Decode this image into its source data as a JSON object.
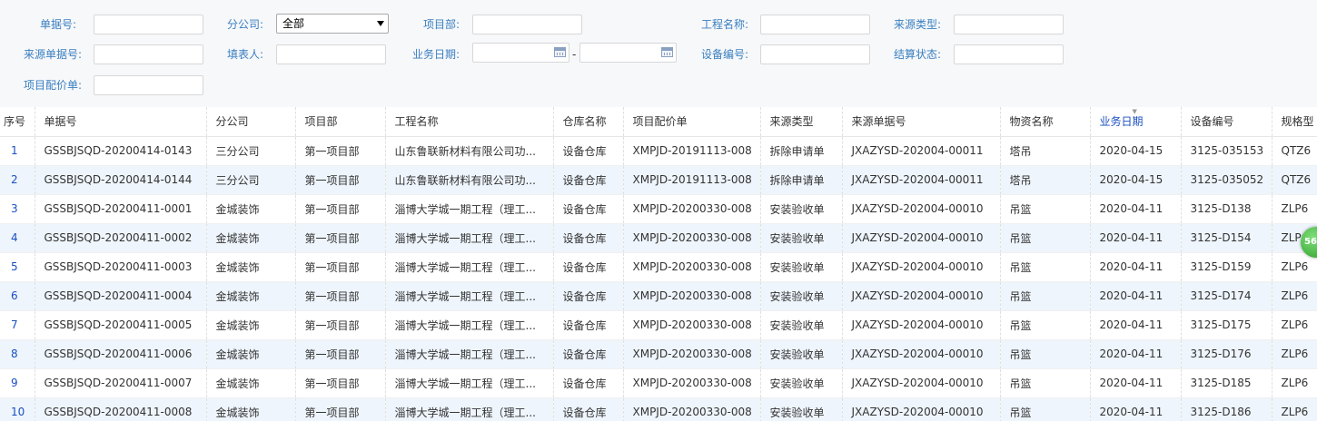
{
  "filters": {
    "doc_no": {
      "label": "单据号:",
      "value": ""
    },
    "branch": {
      "label": "分公司:",
      "value": "全部"
    },
    "project_dept": {
      "label": "项目部:",
      "value": ""
    },
    "project_name": {
      "label": "工程名称:",
      "value": ""
    },
    "source_type": {
      "label": "来源类型:",
      "value": ""
    },
    "source_doc_no": {
      "label": "来源单据号:",
      "value": ""
    },
    "filler": {
      "label": "填表人:",
      "value": ""
    },
    "business_date": {
      "label": "业务日期:",
      "from": "",
      "to": "",
      "separator": "-"
    },
    "equipment_no": {
      "label": "设备编号:",
      "value": ""
    },
    "settlement_status": {
      "label": "结算状态:",
      "value": ""
    },
    "price_list": {
      "label": "项目配价单:",
      "value": ""
    }
  },
  "table": {
    "columns": [
      "序号",
      "单据号",
      "分公司",
      "项目部",
      "工程名称",
      "仓库名称",
      "项目配价单",
      "来源类型",
      "来源单据号",
      "物资名称",
      "业务日期",
      "设备编号",
      "规格型"
    ],
    "sorted_column": "业务日期",
    "rows": [
      [
        "1",
        "GSSBJSQD-20200414-0143",
        "三分公司",
        "第一项目部",
        "山东鲁联新材料有限公司功...",
        "设备仓库",
        "XMPJD-20191113-008",
        "拆除申请单",
        "JXAZYSD-202004-00011",
        "塔吊",
        "2020-04-15",
        "3125-035153",
        "QTZ6"
      ],
      [
        "2",
        "GSSBJSQD-20200414-0144",
        "三分公司",
        "第一项目部",
        "山东鲁联新材料有限公司功...",
        "设备仓库",
        "XMPJD-20191113-008",
        "拆除申请单",
        "JXAZYSD-202004-00011",
        "塔吊",
        "2020-04-15",
        "3125-035052",
        "QTZ6"
      ],
      [
        "3",
        "GSSBJSQD-20200411-0001",
        "金城装饰",
        "第一项目部",
        "淄博大学城一期工程（理工...",
        "设备仓库",
        "XMPJD-20200330-008",
        "安装验收单",
        "JXAZYSD-202004-00010",
        "吊篮",
        "2020-04-11",
        "3125-D138",
        "ZLP6"
      ],
      [
        "4",
        "GSSBJSQD-20200411-0002",
        "金城装饰",
        "第一项目部",
        "淄博大学城一期工程（理工...",
        "设备仓库",
        "XMPJD-20200330-008",
        "安装验收单",
        "JXAZYSD-202004-00010",
        "吊篮",
        "2020-04-11",
        "3125-D154",
        "ZLP6"
      ],
      [
        "5",
        "GSSBJSQD-20200411-0003",
        "金城装饰",
        "第一项目部",
        "淄博大学城一期工程（理工...",
        "设备仓库",
        "XMPJD-20200330-008",
        "安装验收单",
        "JXAZYSD-202004-00010",
        "吊篮",
        "2020-04-11",
        "3125-D159",
        "ZLP6"
      ],
      [
        "6",
        "GSSBJSQD-20200411-0004",
        "金城装饰",
        "第一项目部",
        "淄博大学城一期工程（理工...",
        "设备仓库",
        "XMPJD-20200330-008",
        "安装验收单",
        "JXAZYSD-202004-00010",
        "吊篮",
        "2020-04-11",
        "3125-D174",
        "ZLP6"
      ],
      [
        "7",
        "GSSBJSQD-20200411-0005",
        "金城装饰",
        "第一项目部",
        "淄博大学城一期工程（理工...",
        "设备仓库",
        "XMPJD-20200330-008",
        "安装验收单",
        "JXAZYSD-202004-00010",
        "吊篮",
        "2020-04-11",
        "3125-D175",
        "ZLP6"
      ],
      [
        "8",
        "GSSBJSQD-20200411-0006",
        "金城装饰",
        "第一项目部",
        "淄博大学城一期工程（理工...",
        "设备仓库",
        "XMPJD-20200330-008",
        "安装验收单",
        "JXAZYSD-202004-00010",
        "吊篮",
        "2020-04-11",
        "3125-D176",
        "ZLP6"
      ],
      [
        "9",
        "GSSBJSQD-20200411-0007",
        "金城装饰",
        "第一项目部",
        "淄博大学城一期工程（理工...",
        "设备仓库",
        "XMPJD-20200330-008",
        "安装验收单",
        "JXAZYSD-202004-00010",
        "吊篮",
        "2020-04-11",
        "3125-D185",
        "ZLP6"
      ],
      [
        "10",
        "GSSBJSQD-20200411-0008",
        "金城装饰",
        "第一项目部",
        "淄博大学城一期工程（理工...",
        "设备仓库",
        "XMPJD-20200330-008",
        "安装验收单",
        "JXAZYSD-202004-00010",
        "吊篮",
        "2020-04-11",
        "3125-D186",
        "ZLP6"
      ]
    ]
  },
  "floating_badge": {
    "text": "56",
    "icon": "circle-badge-icon",
    "color": "#2e9e2a"
  },
  "colors": {
    "label": "#3a7fc0",
    "link": "#1a4fc0",
    "stripe": "#eef5fc"
  }
}
